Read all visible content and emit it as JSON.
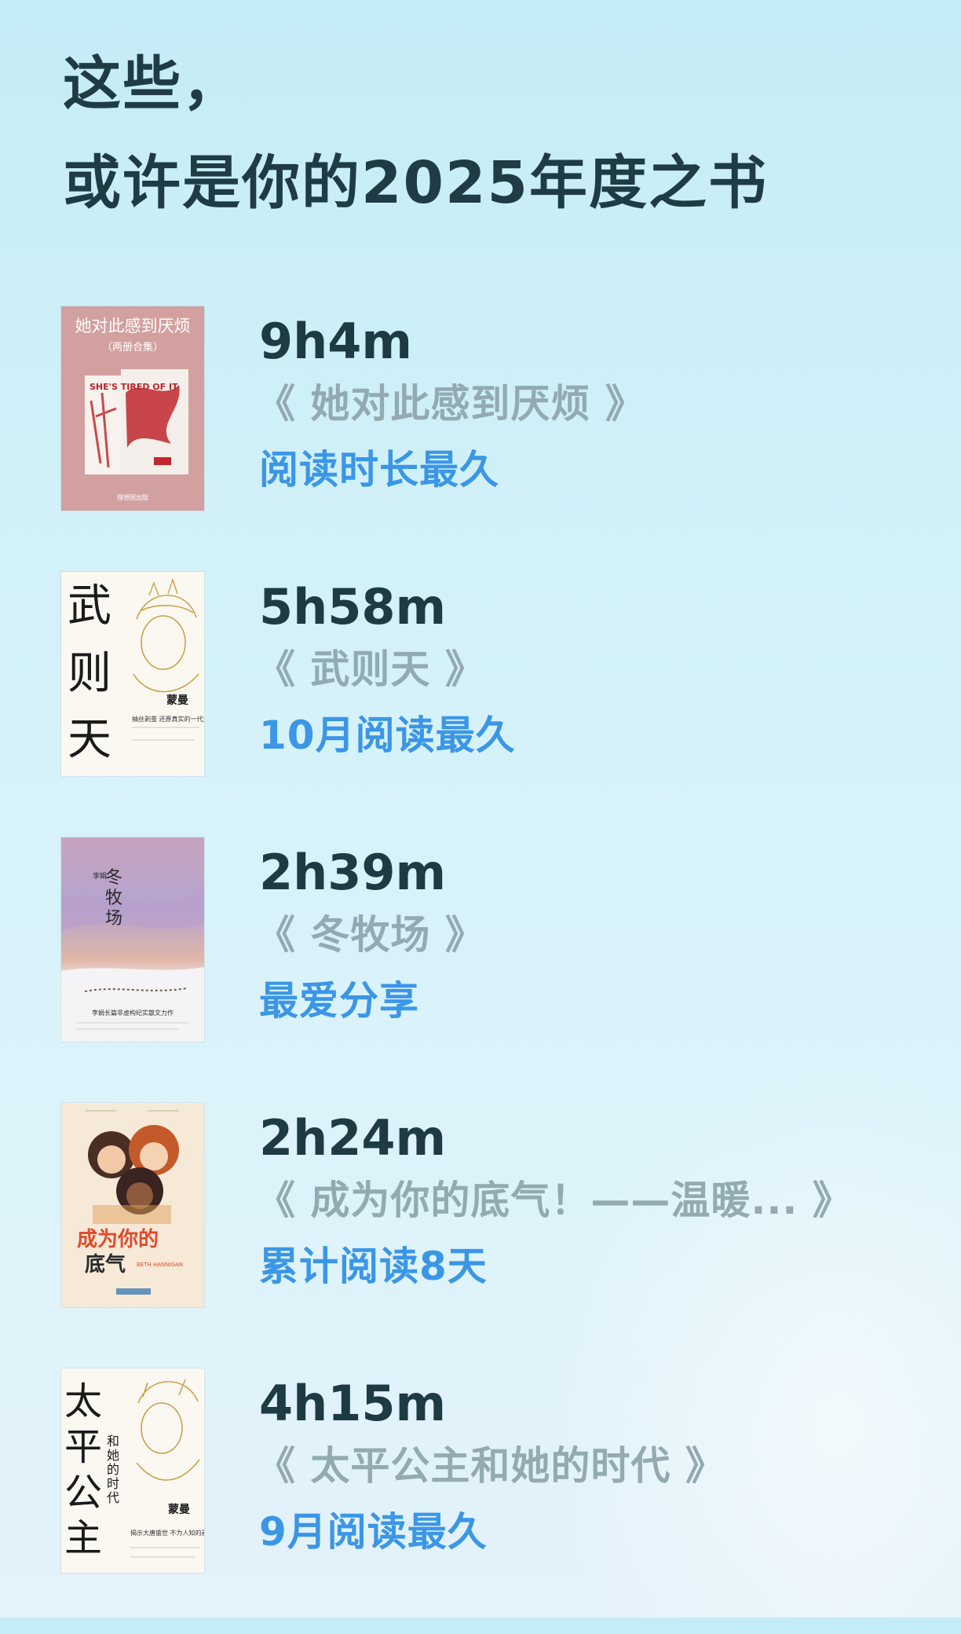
{
  "header": {
    "title_line1": "这些，",
    "title_line2": "或许是你的2025年度之书"
  },
  "books": [
    {
      "duration": "9h4m",
      "title": "《 她对此感到厌烦 》",
      "badge": "阅读时长最久",
      "cover": {
        "title": "她对此感到厌烦",
        "subtitle": "（两册合集）",
        "spine_text": "SHE'S TIRED OF IT",
        "publisher": "理想国出版"
      }
    },
    {
      "duration": "5h58m",
      "title": "《 武则天 》",
      "badge": "10月阅读最久",
      "cover": {
        "title_chars": [
          "武",
          "则",
          "天"
        ],
        "author": "蒙曼",
        "tagline": "抽丝剥茧 还原真实的一代女皇武则天"
      }
    },
    {
      "duration": "2h39m",
      "title": "《 冬牧场 》",
      "badge": "最爱分享",
      "cover": {
        "title_chars": [
          "冬",
          "牧",
          "场"
        ],
        "author": "李娟",
        "tagline": "李娟长篇非虚构纪实散文力作"
      }
    },
    {
      "duration": "2h24m",
      "title": "《 成为你的底气！——温暖... 》",
      "badge": "累计阅读8天",
      "cover": {
        "title_line1": "成为你的",
        "title_line2": "底气",
        "author": "BETH HANNIGAN"
      }
    },
    {
      "duration": "4h15m",
      "title": "《 太平公主和她的时代 》",
      "badge": "9月阅读最久",
      "cover": {
        "title_chars": [
          "太",
          "平",
          "公",
          "主"
        ],
        "subtitle_chars": [
          "和",
          "她",
          "的",
          "时",
          "代"
        ],
        "author": "蒙曼",
        "tagline": "揭示大唐盛世 不为人知的前夜"
      }
    }
  ]
}
